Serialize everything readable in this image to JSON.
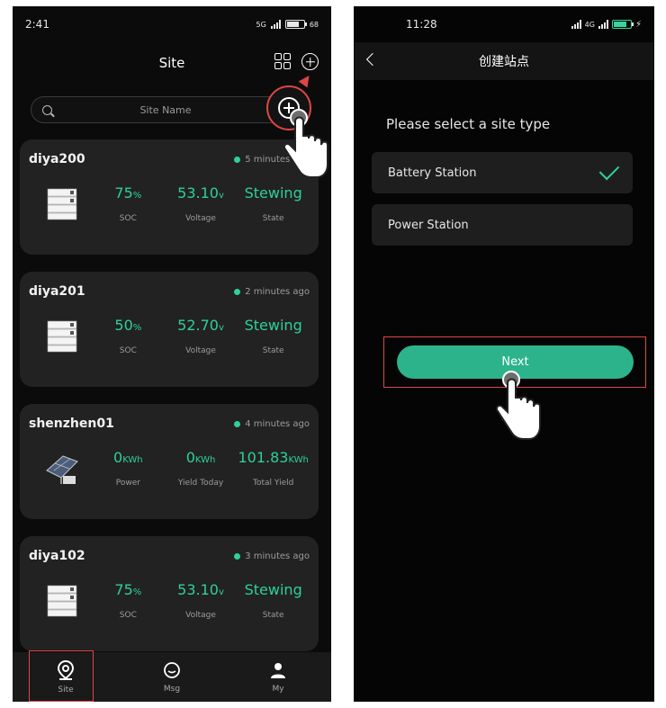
{
  "left": {
    "status": {
      "time": "2:41",
      "network": "5G",
      "battery": "68"
    },
    "header": {
      "title": "Site"
    },
    "search": {
      "placeholder": "Site Name"
    },
    "sites": [
      {
        "name": "diya200",
        "time": "5 minutes ago",
        "type": "battery",
        "metrics": [
          {
            "value": "75",
            "unit": "%",
            "label": "SOC"
          },
          {
            "value": "53.10",
            "unit": "v",
            "label": "Voltage"
          },
          {
            "value": "Stewing",
            "unit": "",
            "label": "State"
          }
        ]
      },
      {
        "name": "diya201",
        "time": "2 minutes ago",
        "type": "battery",
        "metrics": [
          {
            "value": "50",
            "unit": "%",
            "label": "SOC"
          },
          {
            "value": "52.70",
            "unit": "v",
            "label": "Voltage"
          },
          {
            "value": "Stewing",
            "unit": "",
            "label": "State"
          }
        ]
      },
      {
        "name": "shenzhen01",
        "time": "4 minutes ago",
        "type": "solar",
        "metrics": [
          {
            "value": "0",
            "unit": "KWh",
            "label": "Power"
          },
          {
            "value": "0",
            "unit": "KWh",
            "label": "Yield Today"
          },
          {
            "value": "101.83",
            "unit": "KWh",
            "label": "Total Yield"
          }
        ]
      },
      {
        "name": "diya102",
        "time": "3 minutes ago",
        "type": "battery",
        "metrics": [
          {
            "value": "75",
            "unit": "%",
            "label": "SOC"
          },
          {
            "value": "53.10",
            "unit": "v",
            "label": "Voltage"
          },
          {
            "value": "Stewing",
            "unit": "",
            "label": "State"
          }
        ]
      }
    ],
    "nav": [
      {
        "label": "Site",
        "icon": "location-pin-icon"
      },
      {
        "label": "Msg",
        "icon": "chat-bubble-icon"
      },
      {
        "label": "My",
        "icon": "user-icon"
      }
    ]
  },
  "right": {
    "status": {
      "time": "11:28",
      "network": "4G"
    },
    "header": {
      "title": "创建站点"
    },
    "prompt": "Please select a site type",
    "options": [
      {
        "label": "Battery Station",
        "selected": true
      },
      {
        "label": "Power Station",
        "selected": false
      }
    ],
    "next_label": "Next"
  },
  "colors": {
    "accent": "#2fd099",
    "button": "#2db38c",
    "highlight": "#e04545",
    "background": "#0b0b0b",
    "card": "#222222"
  }
}
